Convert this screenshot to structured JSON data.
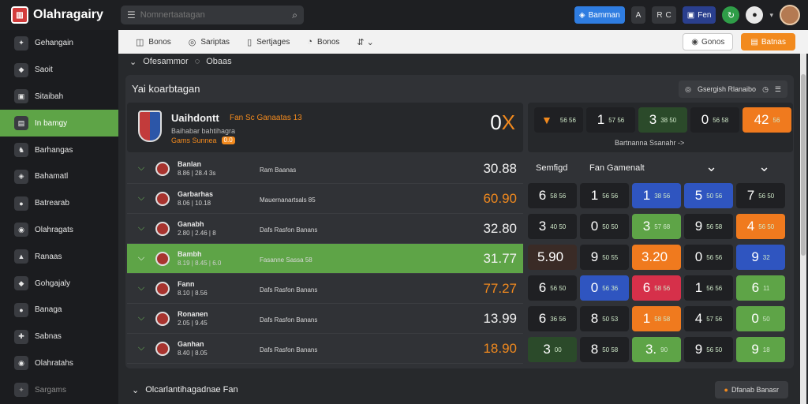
{
  "app": {
    "title": "Olahragairy",
    "logo_glyph": "▥"
  },
  "search": {
    "placeholder": "Nomnertaatagan"
  },
  "topbar": {
    "pill1": "Bamman",
    "pill2": "R",
    "pill3": "Fen",
    "glyph_a": "A",
    "glyph_c": "C"
  },
  "sidebar": {
    "items": [
      {
        "label": "Gehangain",
        "glyph": "✦"
      },
      {
        "label": "Saoit",
        "glyph": "◆"
      },
      {
        "label": "Sitaibah",
        "glyph": "▣"
      },
      {
        "label": "In bamgy",
        "glyph": "▤"
      },
      {
        "label": "Barhangas",
        "glyph": "♞"
      },
      {
        "label": "Bahamatl",
        "glyph": "◈"
      },
      {
        "label": "Batrearab",
        "glyph": "●"
      },
      {
        "label": "Olahragats",
        "glyph": "◉"
      },
      {
        "label": "Ranaas",
        "glyph": "▲"
      },
      {
        "label": "Gohgajaly",
        "glyph": "◆"
      },
      {
        "label": "Banaga",
        "glyph": "●"
      },
      {
        "label": "Sabnas",
        "glyph": "✚"
      },
      {
        "label": "Olahratahs",
        "glyph": "◉"
      },
      {
        "label": "Sargams",
        "glyph": "✦"
      }
    ]
  },
  "tabs": [
    {
      "label": "Bonos",
      "glyph": "◫"
    },
    {
      "label": "Sariptas",
      "glyph": "◎"
    },
    {
      "label": "Sertjages",
      "glyph": "▯"
    },
    {
      "label": "Bonos",
      "glyph": "◔"
    },
    {
      "label": "",
      "glyph": "⇵ ⌄"
    }
  ],
  "actions": {
    "outline": "Gonos",
    "orange": "Batnas"
  },
  "subhead": {
    "left": "Ofesammor",
    "right": "Obaas"
  },
  "panel": {
    "title": "Yai koarbtagan",
    "tools": "Gsergish  Rlanaibo"
  },
  "hero": {
    "name": "Uaihdontt",
    "tag": "Fan Sc Ganaatas 13",
    "line2": "Baihabar bahtihagra",
    "line3": "Gams Sunnea",
    "badge": "0.0",
    "score_left": "0",
    "score_right": "X"
  },
  "rows": [
    {
      "name": "Banlan",
      "sub": "8.86 | 28.4  3s",
      "extra": "Ram Baanas",
      "value": "30.88",
      "color": "#f2f2f2",
      "hl": false
    },
    {
      "name": "Garbarhas",
      "sub": "8.06 | 10.18",
      "extra": "Mauernanartsals 85",
      "value": "60.90",
      "color": "#f28a1e",
      "hl": false
    },
    {
      "name": "Ganabh",
      "sub": "2.80 | 2.46 | 8",
      "extra": "Dafs  Rasfon Banans",
      "value": "32.80",
      "color": "#f2f2f2",
      "hl": false
    },
    {
      "name": "Bambh",
      "sub": "8.19 | 8.45 | 6.0",
      "extra": "Fasanne Sassa 58",
      "value": "31.77",
      "color": "#f2f2f2",
      "hl": true
    },
    {
      "name": "Fann",
      "sub": "8.10 | 8.56",
      "extra": "Dafs  Rasfon Banans",
      "value": "77.27",
      "color": "#f28a1e",
      "hl": false
    },
    {
      "name": "Ronanen",
      "sub": "2.05 | 9.45",
      "extra": "Dafs  Rasfon Banans",
      "value": "13.99",
      "color": "#f2f2f2",
      "hl": false
    },
    {
      "name": "Ganhan",
      "sub": "8.40 | 8.05",
      "extra": "Dafs  Rasfon Banans",
      "value": "18.90",
      "color": "#f28a1e",
      "hl": false
    }
  ],
  "odds_head": {
    "cells": [
      {
        "big": "",
        "small": "56 56",
        "cls": "c-dark"
      },
      {
        "big": "1",
        "small": "57 56",
        "cls": "c-dark"
      },
      {
        "big": "3",
        "small": "38 50",
        "cls": "c-dgreen"
      },
      {
        "big": "0",
        "small": "56 58",
        "cls": "c-dark"
      },
      {
        "big": "42",
        "small": "56",
        "cls": "c-orange"
      }
    ],
    "caption": "Bartnanna Ssanahr ->"
  },
  "odds_labels": {
    "a": "Semfigd",
    "b": "Fan Gamenalt",
    "c": "⌄",
    "d": "⌄"
  },
  "odds": [
    [
      {
        "b": "6",
        "s": "58 56",
        "c": "c-dark"
      },
      {
        "b": "1",
        "s": "56 56",
        "c": "c-dark"
      },
      {
        "b": "1",
        "s": "38 56",
        "c": "c-blue"
      },
      {
        "b": "5",
        "s": "50 56",
        "c": "c-blue"
      },
      {
        "b": "7",
        "s": "56 50",
        "c": "c-dark"
      }
    ],
    [
      {
        "b": "3",
        "s": "40 50",
        "c": "c-dark"
      },
      {
        "b": "0",
        "s": "50 50",
        "c": "c-dark"
      },
      {
        "b": "3",
        "s": "57 68",
        "c": "c-green"
      },
      {
        "b": "9",
        "s": "56 58",
        "c": "c-dark"
      },
      {
        "b": "4",
        "s": "56 50",
        "c": "c-orange"
      }
    ],
    [
      {
        "b": "5.90",
        "s": "",
        "c": "c-brown"
      },
      {
        "b": "9",
        "s": "50 55",
        "c": "c-dark"
      },
      {
        "b": "3.20",
        "s": "",
        "c": "c-orange"
      },
      {
        "b": "0",
        "s": "56 56",
        "c": "c-dark"
      },
      {
        "b": "9",
        "s": "32",
        "c": "c-blue"
      }
    ],
    [
      {
        "b": "6",
        "s": "56 50",
        "c": "c-dark"
      },
      {
        "b": "0",
        "s": "56 36",
        "c": "c-blue"
      },
      {
        "b": "6",
        "s": "58 56",
        "c": "c-red"
      },
      {
        "b": "1",
        "s": "56 56",
        "c": "c-dark"
      },
      {
        "b": "6",
        "s": "11",
        "c": "c-green"
      }
    ],
    [
      {
        "b": "6",
        "s": "36 56",
        "c": "c-dark"
      },
      {
        "b": "8",
        "s": "50 53",
        "c": "c-dark"
      },
      {
        "b": "1",
        "s": "58 58",
        "c": "c-orange"
      },
      {
        "b": "4",
        "s": "57 56",
        "c": "c-dark"
      },
      {
        "b": "0",
        "s": "50",
        "c": "c-green"
      }
    ],
    [
      {
        "b": "3",
        "s": "00",
        "c": "c-dgreen"
      },
      {
        "b": "8",
        "s": "50 58",
        "c": "c-dark"
      },
      {
        "b": "3.",
        "s": "90",
        "c": "c-green"
      },
      {
        "b": "9",
        "s": "56 50",
        "c": "c-dark"
      },
      {
        "b": "9",
        "s": "18",
        "c": "c-green"
      }
    ]
  ],
  "bottom": {
    "title": "Olcarlantihagadnae Fan",
    "pill": "Dfanab Banasr"
  }
}
